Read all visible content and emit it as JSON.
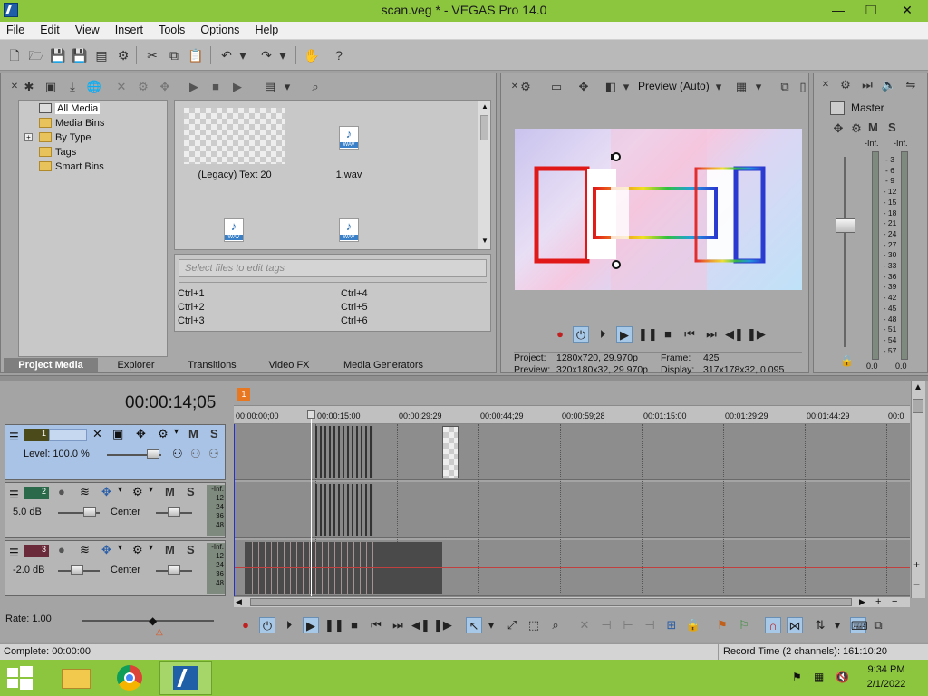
{
  "window": {
    "title": "scan.veg * - VEGAS Pro 14.0",
    "minimize": "—",
    "restore": "❐",
    "close": "✕"
  },
  "menu": [
    "File",
    "Edit",
    "View",
    "Insert",
    "Tools",
    "Options",
    "Help"
  ],
  "project_media": {
    "tree": [
      "All Media",
      "Media Bins",
      "By Type",
      "Tags",
      "Smart Bins"
    ],
    "expand_glyph": "+",
    "files": [
      {
        "name": "(Legacy) Text 20",
        "kind": "text"
      },
      {
        "name": "1.wav",
        "kind": "wav"
      },
      {
        "name": "",
        "kind": "wav"
      },
      {
        "name": "",
        "kind": "wav"
      }
    ],
    "tags_placeholder": "Select files to edit tags",
    "shortcuts": [
      "Ctrl+1",
      "Ctrl+4",
      "Ctrl+2",
      "Ctrl+5",
      "Ctrl+3",
      "Ctrl+6"
    ],
    "tabs": [
      "Project Media",
      "Explorer",
      "Transitions",
      "Video FX",
      "Media Generators"
    ]
  },
  "preview": {
    "mode": "Preview (Auto)",
    "project_label": "Project:",
    "project_value": "1280x720, 29.970p",
    "preview_label": "Preview:",
    "preview_value": "320x180x32, 29.970p",
    "frame_label": "Frame:",
    "frame_value": "425",
    "display_label": "Display:",
    "display_value": "317x178x32, 0.095"
  },
  "master": {
    "title": "Master",
    "inf_left": "-Inf.",
    "inf_right": "-Inf.",
    "scale": [
      "3",
      "6",
      "9",
      "12",
      "15",
      "18",
      "21",
      "24",
      "27",
      "30",
      "33",
      "36",
      "39",
      "42",
      "45",
      "48",
      "51",
      "54",
      "57"
    ],
    "bottom_left": "0.0",
    "bottom_right": "0.0",
    "m": "M",
    "s": "S"
  },
  "timeline": {
    "timecode": "00:00:14;05",
    "marker": "1",
    "ruler": [
      "00:00:00;00",
      "00:00:15:00",
      "00:00:29:29",
      "00:00:44;29",
      "00:00:59;28",
      "00:01:15:00",
      "00:01:29:29",
      "00:01:44:29",
      "00:0"
    ],
    "tracks": [
      {
        "num": "1",
        "level": "Level: 100.0 %",
        "m": "M",
        "s": "S"
      },
      {
        "num": "2",
        "db": "5.0 dB",
        "pan": "Center",
        "m": "M",
        "s": "S",
        "meter": [
          "-Inf.",
          "12",
          "24",
          "36",
          "48"
        ]
      },
      {
        "num": "3",
        "db": "-2.0 dB",
        "pan": "Center",
        "m": "M",
        "s": "S",
        "meter": [
          "-Inf.",
          "12",
          "24",
          "36",
          "48"
        ]
      }
    ],
    "rate": "Rate: 1.00"
  },
  "status": {
    "left": "Complete: 00:00:00",
    "right": "Record Time (2 channels): 161:10:20"
  },
  "taskbar": {
    "time": "9:34 PM",
    "date": "2/1/2022"
  },
  "colors": {
    "titlebar": "#8cc63f",
    "track_video_selected": "#a9c3e6",
    "track_audio": "#b6b6b6"
  }
}
